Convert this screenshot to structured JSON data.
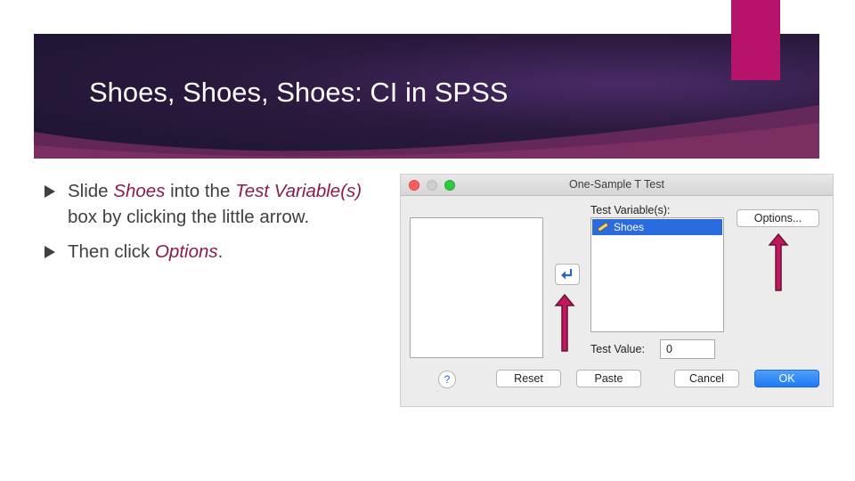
{
  "slide": {
    "title": "Shoes, Shoes, Shoes: CI in SPSS",
    "bullets": [
      {
        "parts": [
          "Slide ",
          "Shoes",
          " into the ",
          "Test Variable(s)",
          " box by clicking the little arrow."
        ]
      },
      {
        "parts": [
          "Then click ",
          "Options",
          "."
        ]
      }
    ],
    "colors": {
      "accent": "#b8136a",
      "banner": "#2a1a3e",
      "emphasis": "#8b1b4f",
      "arrow": "#c0185f"
    }
  },
  "dialog": {
    "title": "One-Sample T Test",
    "test_variables_label": "Test Variable(s):",
    "selected_variable": "Shoes",
    "variable_icon": "ruler-icon",
    "move_button_icon": "return-arrow-icon",
    "options_label": "Options...",
    "test_value_label": "Test Value:",
    "test_value": "0",
    "help_label": "?",
    "buttons": {
      "reset": "Reset",
      "paste": "Paste",
      "cancel": "Cancel",
      "ok": "OK"
    }
  }
}
